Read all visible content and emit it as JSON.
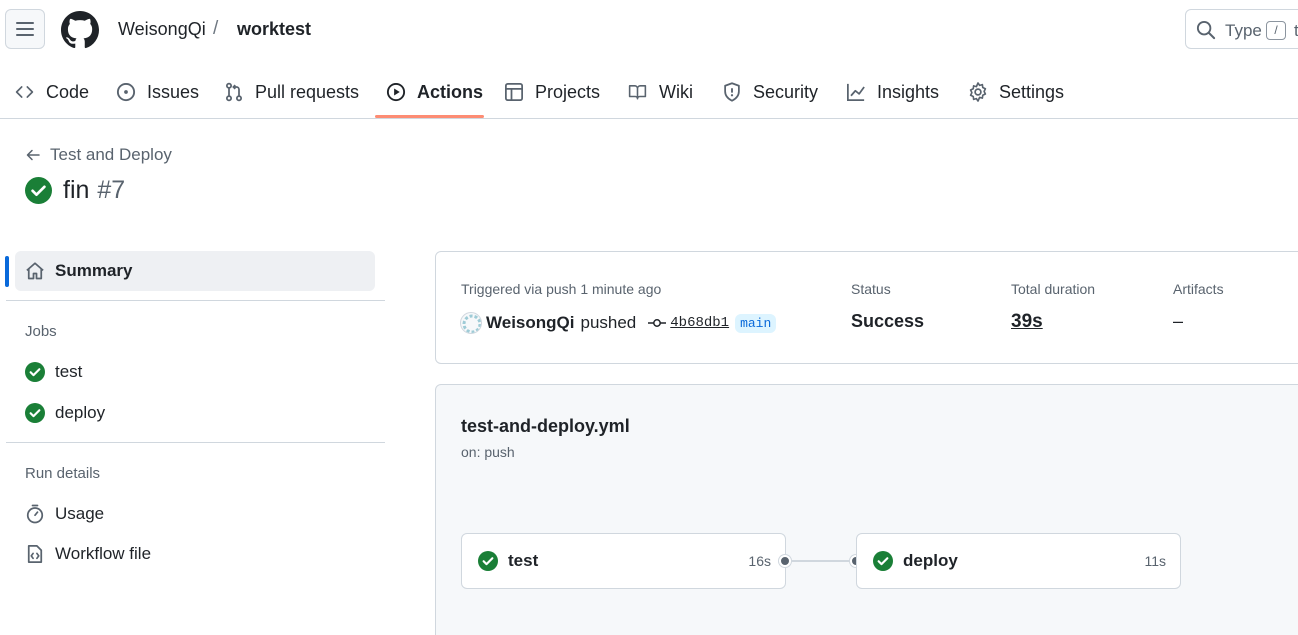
{
  "header": {
    "owner": "WeisongQi",
    "separator": "/",
    "repo": "worktest",
    "search_placeholder": "Type",
    "search_key": "/",
    "search_tail": "to"
  },
  "tabs": [
    {
      "label": "Code",
      "icon": "code-icon"
    },
    {
      "label": "Issues",
      "icon": "issue-icon"
    },
    {
      "label": "Pull requests",
      "icon": "pull-request-icon"
    },
    {
      "label": "Actions",
      "icon": "play-icon",
      "active": true
    },
    {
      "label": "Projects",
      "icon": "table-icon"
    },
    {
      "label": "Wiki",
      "icon": "book-icon"
    },
    {
      "label": "Security",
      "icon": "shield-icon"
    },
    {
      "label": "Insights",
      "icon": "graph-icon"
    },
    {
      "label": "Settings",
      "icon": "gear-icon"
    }
  ],
  "run": {
    "back_label": "Test and Deploy",
    "name": "fin",
    "number": "#7"
  },
  "sidebar": {
    "summary": "Summary",
    "jobs_heading": "Jobs",
    "jobs": [
      "test",
      "deploy"
    ],
    "details_heading": "Run details",
    "usage": "Usage",
    "workflow_file": "Workflow file"
  },
  "summary": {
    "triggered_label": "Triggered via push 1 minute ago",
    "actor": "WeisongQi",
    "action": "pushed",
    "commit": "4b68db1",
    "branch": "main",
    "status_label": "Status",
    "status_value": "Success",
    "duration_label": "Total duration",
    "duration_value": "39s",
    "artifacts_label": "Artifacts",
    "artifacts_value": "–"
  },
  "workflow": {
    "file": "test-and-deploy.yml",
    "trigger": "on: push",
    "jobs": [
      {
        "name": "test",
        "time": "16s"
      },
      {
        "name": "deploy",
        "time": "11s"
      }
    ]
  },
  "colors": {
    "success": "#1a7f37",
    "accent": "#0969da",
    "tab_underline": "#fd8c73"
  }
}
